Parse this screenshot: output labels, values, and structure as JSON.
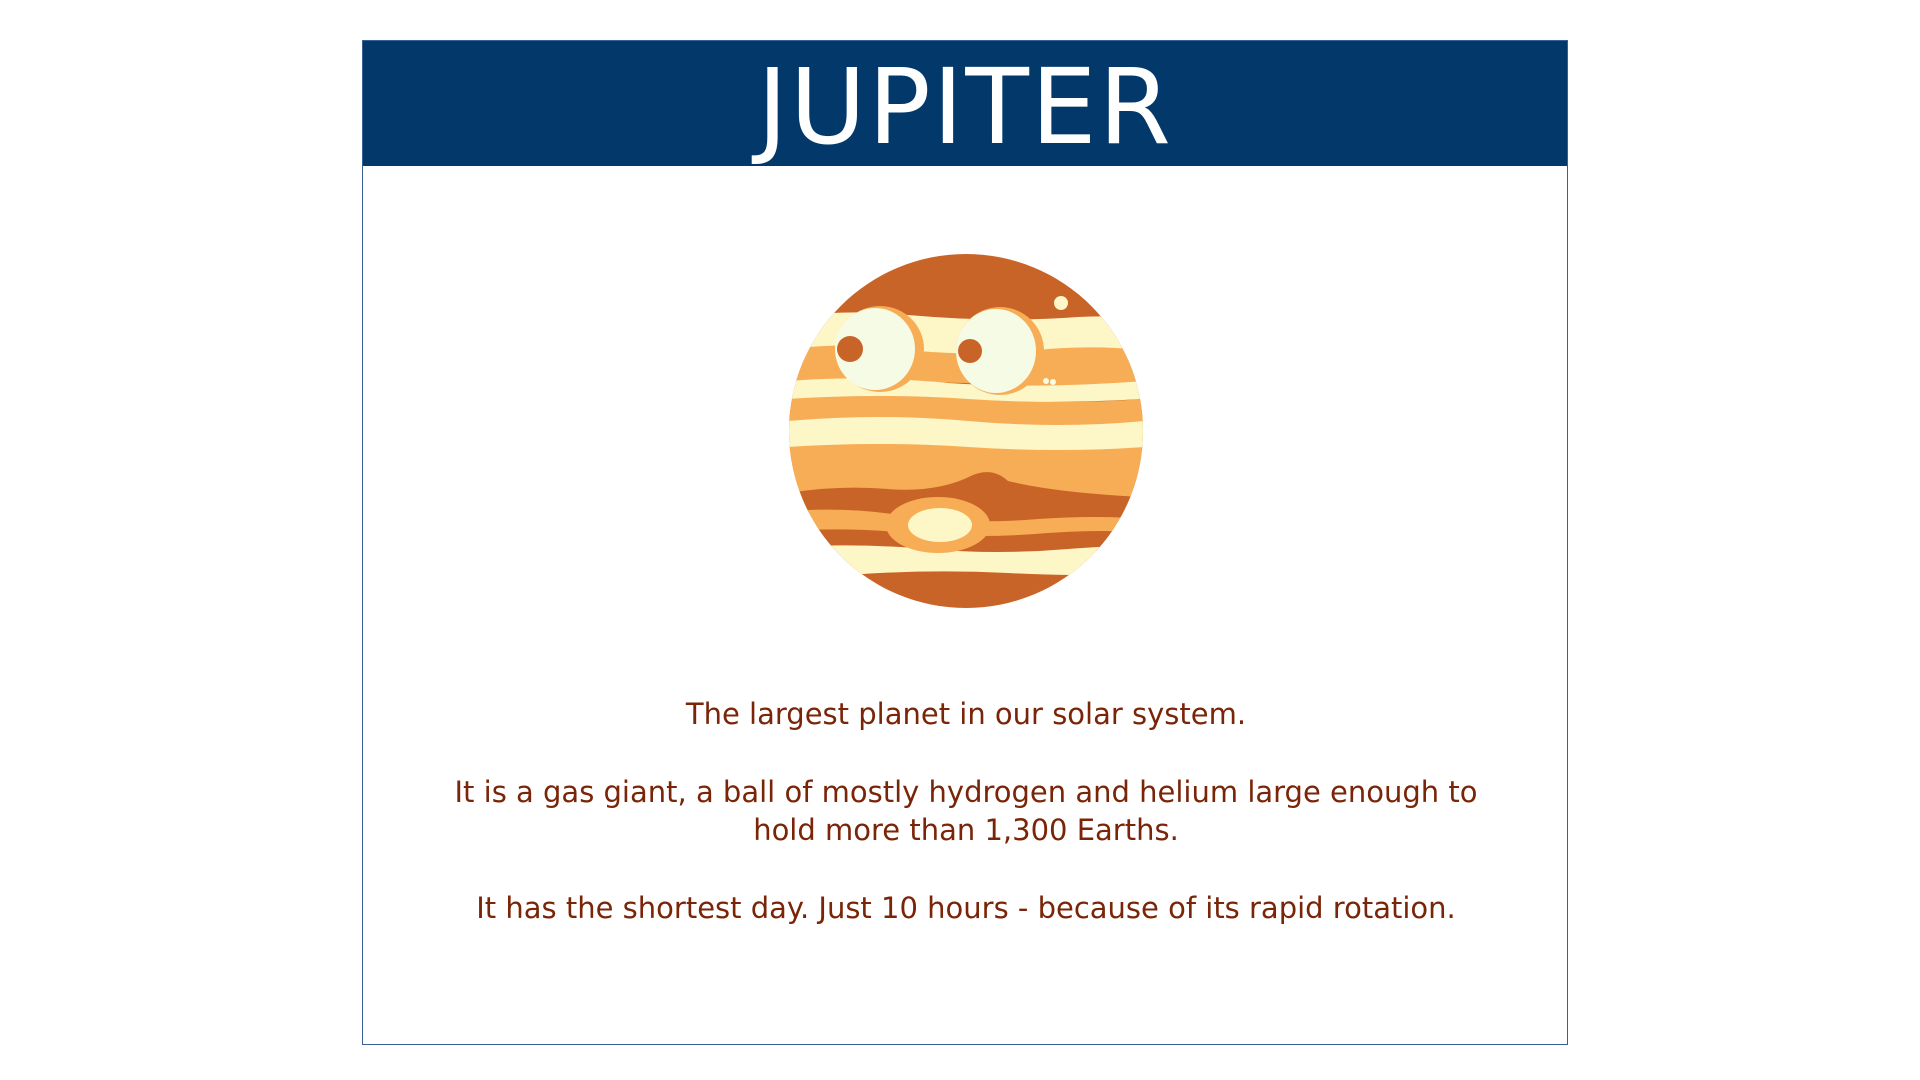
{
  "slide": {
    "title": "JUPITER",
    "illustration_icon": "jupiter-cartoon-planet-icon",
    "facts": [
      "The largest planet in our solar system.",
      "It is a gas giant, a ball of mostly hydrogen and helium large enough to hold more than 1,300 Earths.",
      "It has the shortest day. Just 10 hours - because of its rapid rotation."
    ]
  },
  "colors": {
    "header_background": "#03396a",
    "title_text": "#ffffff",
    "card_border": "#3a5f94",
    "fact_text": "#7a2408",
    "planet_dark_band": "#c96428",
    "planet_mid_band": "#f7ad55",
    "planet_light_band": "#fdf6c6",
    "planet_eye_white": "#f6fbe6"
  }
}
